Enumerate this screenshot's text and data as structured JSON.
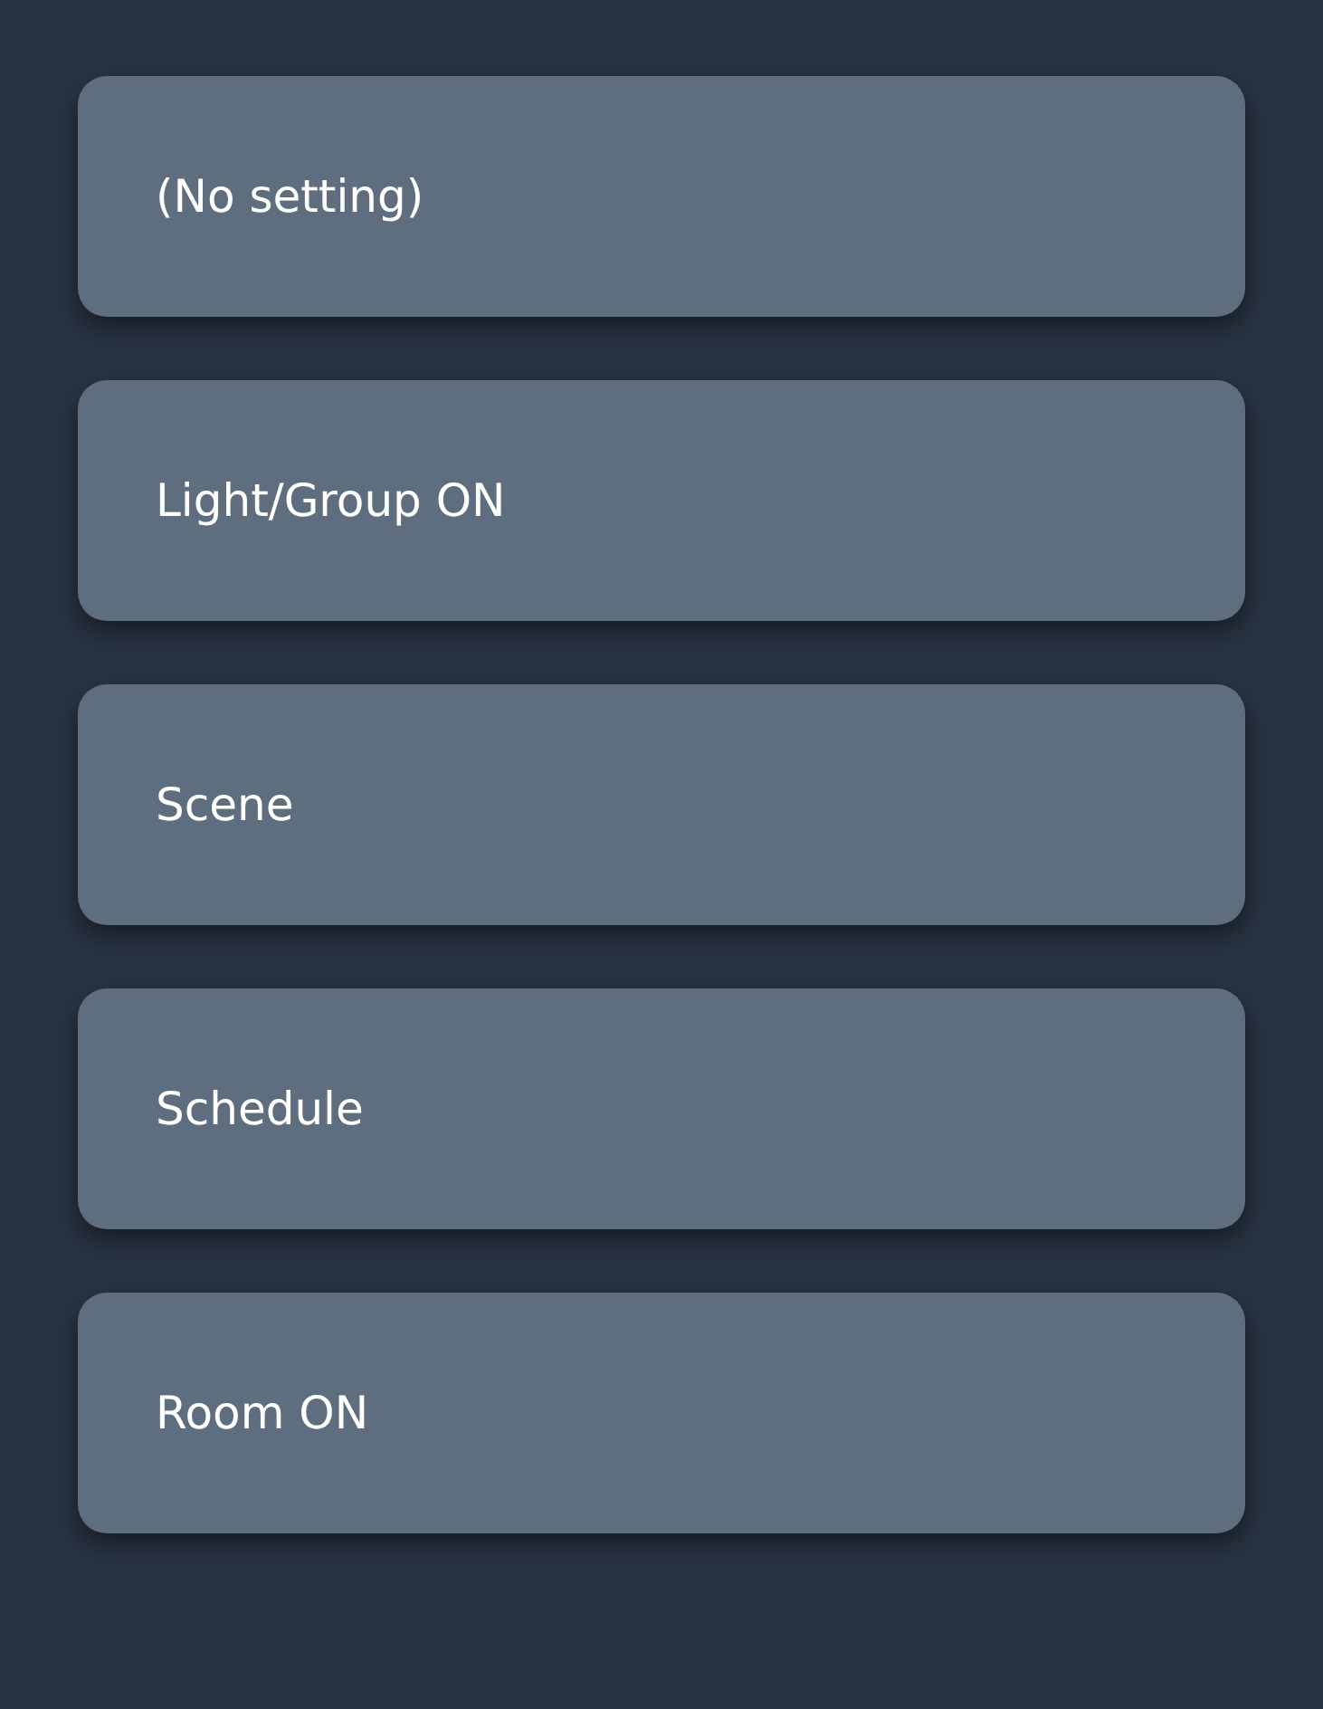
{
  "options": [
    {
      "label": "(No setting)"
    },
    {
      "label": "Light/Group ON"
    },
    {
      "label": "Scene"
    },
    {
      "label": "Schedule"
    },
    {
      "label": "Room ON"
    }
  ]
}
